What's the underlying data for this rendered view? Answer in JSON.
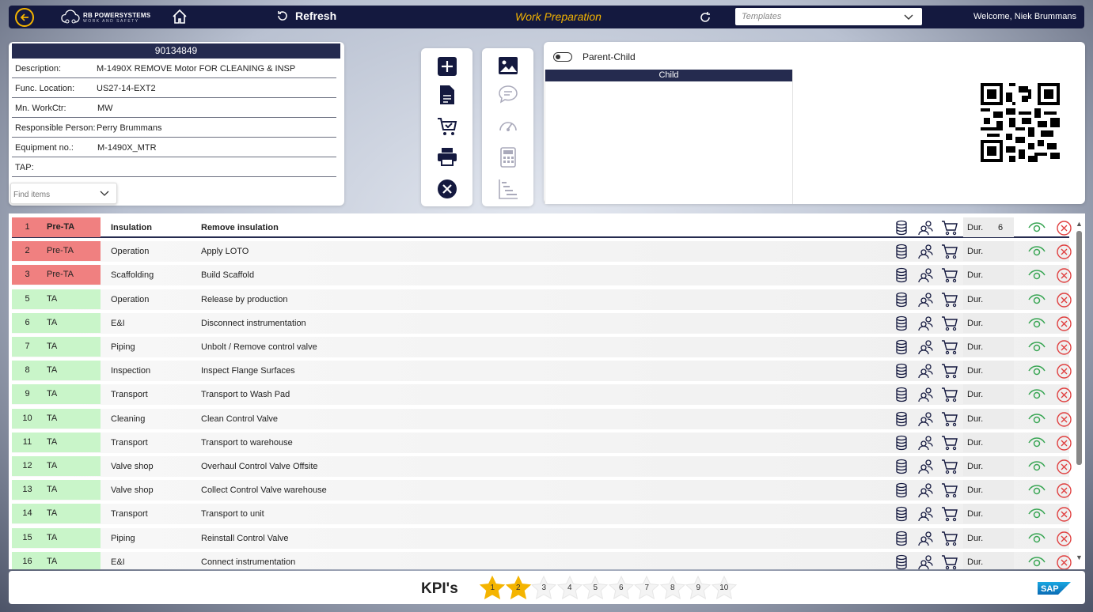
{
  "topbar": {
    "logo_line1": "RB POWERSYSTEMS",
    "logo_line2": "WORK AND SAFETY",
    "refresh_label": "Refresh",
    "page_title": "Work Preparation",
    "templates_placeholder": "Templates",
    "welcome": "Welcome, Niek Brummans",
    "accent": "#f4b400",
    "bar_color": "#14193f"
  },
  "info": {
    "order_number": "90134849",
    "rows": [
      {
        "label": "Description:",
        "value": "M-1490X REMOVE Motor FOR CLEANING & INSP"
      },
      {
        "label": "Func. Location:",
        "value": "US27-14-EXT2"
      },
      {
        "label": "Mn. WorkCtr:",
        "value": "MW"
      },
      {
        "label": "Responsible Person:",
        "value": "Perry Brummans"
      },
      {
        "label": "Equipment no.:",
        "value": "M-1490X_MTR"
      },
      {
        "label": "TAP:",
        "value": ""
      }
    ],
    "find_placeholder": "Find items"
  },
  "toolbar_left": [
    "add-icon",
    "document-icon",
    "cart-check-icon",
    "print-icon",
    "close-circle-icon"
  ],
  "toolbar_right": [
    "image-icon",
    "comment-icon",
    "gauge-icon",
    "calculator-icon",
    "gantt-icon"
  ],
  "parent_child": {
    "toggle_label": "Parent-Child",
    "child_header": "Child"
  },
  "operations": {
    "dur_label": "Dur.",
    "rows": [
      {
        "num": "1",
        "phase": "Pre-TA",
        "category": "Insulation",
        "description": "Remove insulation",
        "dur": "6"
      },
      {
        "num": "2",
        "phase": "Pre-TA",
        "category": "Operation",
        "description": "Apply LOTO",
        "dur": ""
      },
      {
        "num": "3",
        "phase": "Pre-TA",
        "category": "Scaffolding",
        "description": "Build Scaffold",
        "dur": ""
      },
      {
        "num": "5",
        "phase": "TA",
        "category": "Operation",
        "description": "Release by production",
        "dur": ""
      },
      {
        "num": "6",
        "phase": "TA",
        "category": "E&I",
        "description": "Disconnect instrumentation",
        "dur": ""
      },
      {
        "num": "7",
        "phase": "TA",
        "category": "Piping",
        "description": "Unbolt / Remove control valve",
        "dur": ""
      },
      {
        "num": "8",
        "phase": "TA",
        "category": "Inspection",
        "description": "Inspect Flange Surfaces",
        "dur": ""
      },
      {
        "num": "9",
        "phase": "TA",
        "category": "Transport",
        "description": "Transport to Wash Pad",
        "dur": ""
      },
      {
        "num": "10",
        "phase": "TA",
        "category": "Cleaning",
        "description": "Clean Control Valve",
        "dur": ""
      },
      {
        "num": "11",
        "phase": "TA",
        "category": "Transport",
        "description": "Transport to warehouse",
        "dur": ""
      },
      {
        "num": "12",
        "phase": "TA",
        "category": "Valve shop",
        "description": "Overhaul Control Valve Offsite",
        "dur": ""
      },
      {
        "num": "13",
        "phase": "TA",
        "category": "Valve shop",
        "description": "Collect Control Valve warehouse",
        "dur": ""
      },
      {
        "num": "14",
        "phase": "TA",
        "category": "Transport",
        "description": "Transport to unit",
        "dur": ""
      },
      {
        "num": "15",
        "phase": "TA",
        "category": "Piping",
        "description": "Reinstall Control Valve",
        "dur": ""
      },
      {
        "num": "16",
        "phase": "TA",
        "category": "E&I",
        "description": "Connect instrumentation",
        "dur": ""
      }
    ],
    "colors": {
      "pre_ta": "#f08080",
      "ta": "#c9f5c9",
      "eye": "#3aa655",
      "delete": "#e04040"
    }
  },
  "kpi": {
    "title": "KPI's",
    "stars": [
      "1",
      "2",
      "3",
      "4",
      "5",
      "6",
      "7",
      "8",
      "9",
      "10"
    ],
    "rating": 2,
    "star_color": "#f4b400"
  },
  "footer": {
    "sap_logo": "SAP"
  }
}
